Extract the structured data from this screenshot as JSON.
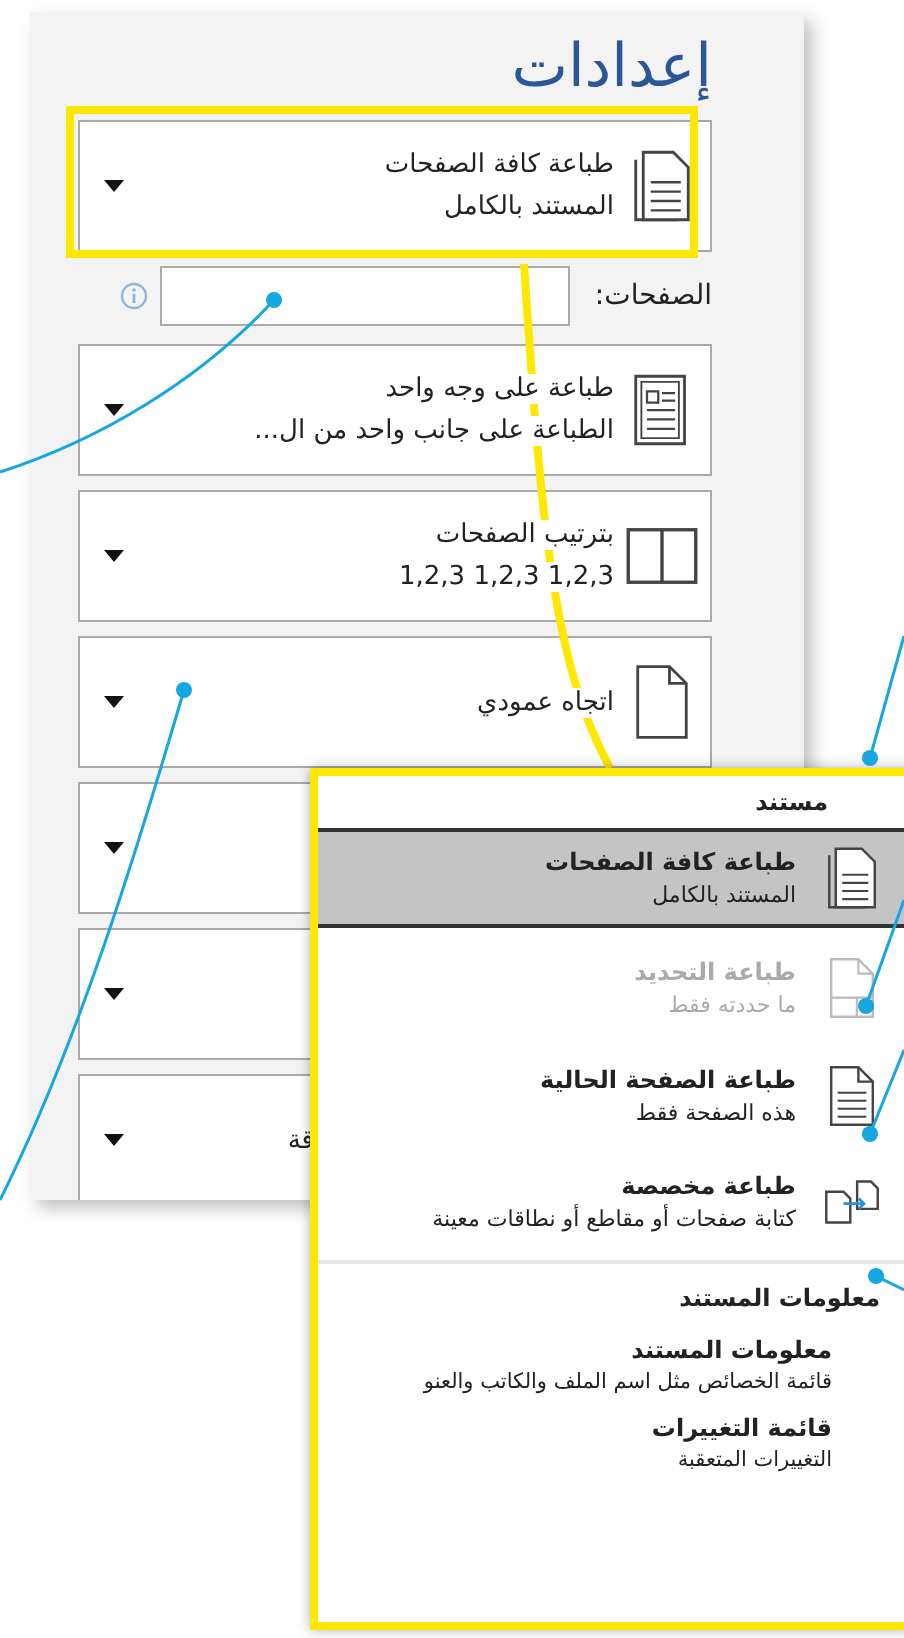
{
  "panel": {
    "title": "إعدادات",
    "dropdowns": [
      {
        "kind": "pages",
        "title": "طباعة كافة الصفحات",
        "subtitle": "المستند بالكامل"
      },
      {
        "kind": "range",
        "label": "الصفحات:"
      },
      {
        "kind": "sides",
        "title": "طباعة على وجه واحد",
        "subtitle": "الطباعة على جانب واحد من ال..."
      },
      {
        "kind": "collate",
        "title": "بترتيب الصفحات",
        "subtitle": "1,2,3   1,2,3   1,2,3"
      },
      {
        "kind": "orientation",
        "title": "اتجاه عمودي"
      },
      {
        "kind": "hidden"
      },
      {
        "kind": "hidden"
      },
      {
        "kind": "hidden",
        "title": "قة"
      }
    ]
  },
  "popup": {
    "header": "مستند",
    "items": [
      {
        "kind": "all",
        "title": "طباعة كافة الصفحات",
        "subtitle": "المستند بالكامل",
        "selected": true,
        "disabled": false
      },
      {
        "kind": "selection",
        "title": "طباعة التحديد",
        "subtitle": "ما حددته فقط",
        "selected": false,
        "disabled": true
      },
      {
        "kind": "current",
        "title": "طباعة الصفحة الحالية",
        "subtitle": "هذه الصفحة فقط",
        "selected": false,
        "disabled": false
      },
      {
        "kind": "custom",
        "title": "طباعة مخصصة",
        "subtitle": "كتابة صفحات أو مقاطع أو نطاقات معينة",
        "selected": false,
        "disabled": false
      }
    ],
    "section": "معلومات المستند",
    "info_items": [
      {
        "title": "معلومات المستند",
        "subtitle": "قائمة الخصائص مثل اسم الملف والكاتب والعنو"
      },
      {
        "title": "قائمة التغييرات",
        "subtitle": "التغييرات المتعقبة"
      }
    ]
  }
}
